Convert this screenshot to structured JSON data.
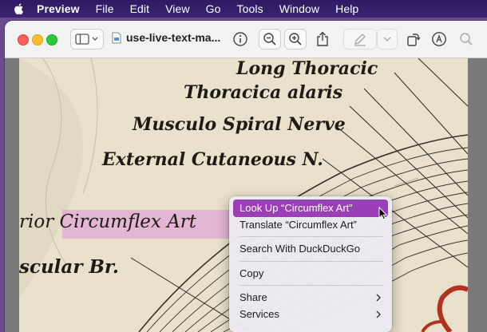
{
  "menubar": {
    "app_name": "Preview",
    "items": [
      "File",
      "Edit",
      "View",
      "Go",
      "Tools",
      "Window",
      "Help"
    ]
  },
  "window": {
    "title": "use-live-text-ma..."
  },
  "illustration_labels": {
    "line1": "Long Thoracic",
    "line2": "Thoracica alaris",
    "line3": "Musculo Spiral Nerve",
    "line4": "External Cutaneous N.",
    "line5": "rior Circumflex Art",
    "line6": "scular Br."
  },
  "context_menu": {
    "items": [
      {
        "label": "Look Up “Circumflex Art”",
        "selected": true
      },
      {
        "label": "Translate “Circumflex Art”"
      },
      {
        "label": "Search With DuckDuckGo"
      },
      {
        "label": "Copy"
      },
      {
        "label": "Share",
        "submenu": true
      },
      {
        "label": "Services",
        "submenu": true
      }
    ]
  },
  "colors": {
    "selection": "#9b3fb7",
    "highlight": "#db82dc",
    "paper": "#e9e1cc"
  }
}
